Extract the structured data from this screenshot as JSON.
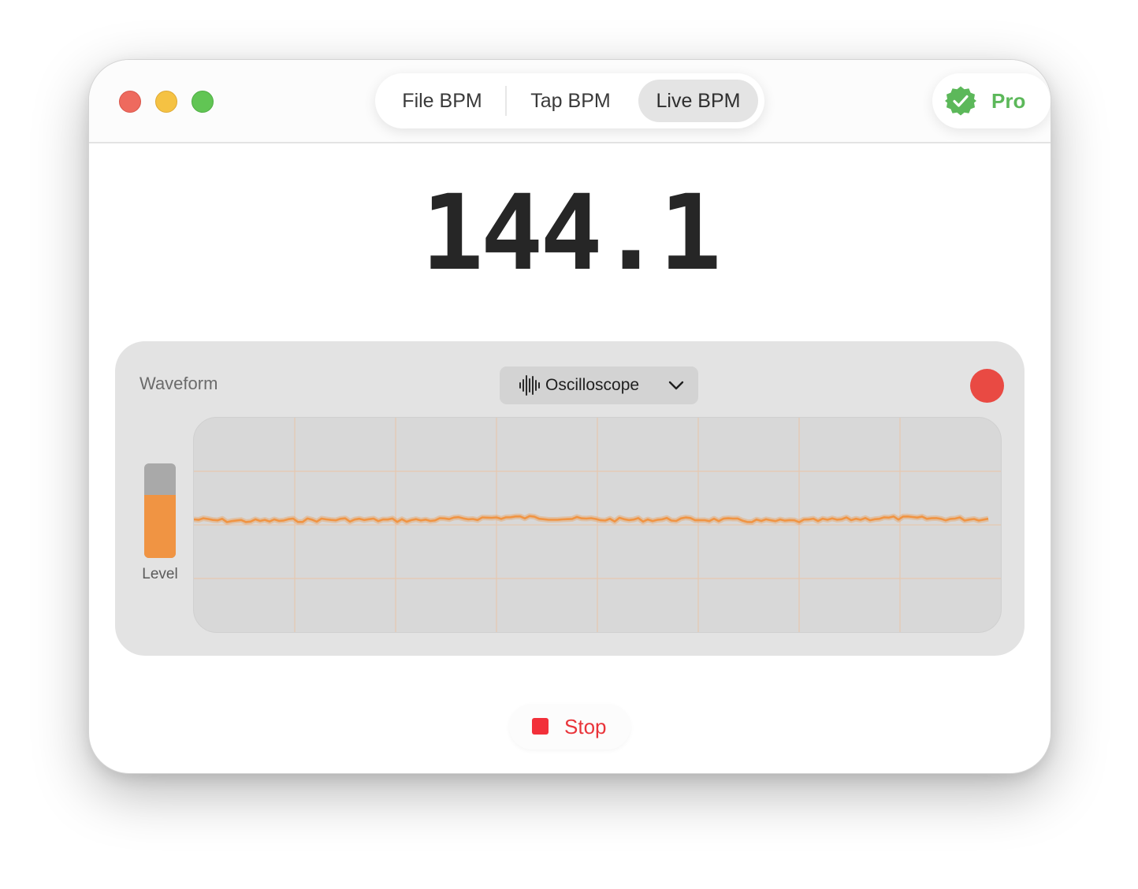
{
  "tabs": [
    {
      "label": "File BPM",
      "selected": false
    },
    {
      "label": "Tap BPM",
      "selected": false
    },
    {
      "label": "Live BPM",
      "selected": true
    }
  ],
  "pro_badge": {
    "label": "Pro",
    "icon": "verified-badge-icon",
    "color": "#5cb85a"
  },
  "bpm_value": "144.1",
  "waveform_panel": {
    "label": "Waveform",
    "mode_select": {
      "selected": "Oscilloscope",
      "icon": "waveform-icon"
    },
    "record_indicator_color": "#e94a43",
    "level": {
      "label": "Level",
      "value": 0.67,
      "fill_color": "#f09443"
    },
    "trace_color": "#f09443"
  },
  "stop_button": {
    "label": "Stop",
    "color": "#e9343a"
  }
}
